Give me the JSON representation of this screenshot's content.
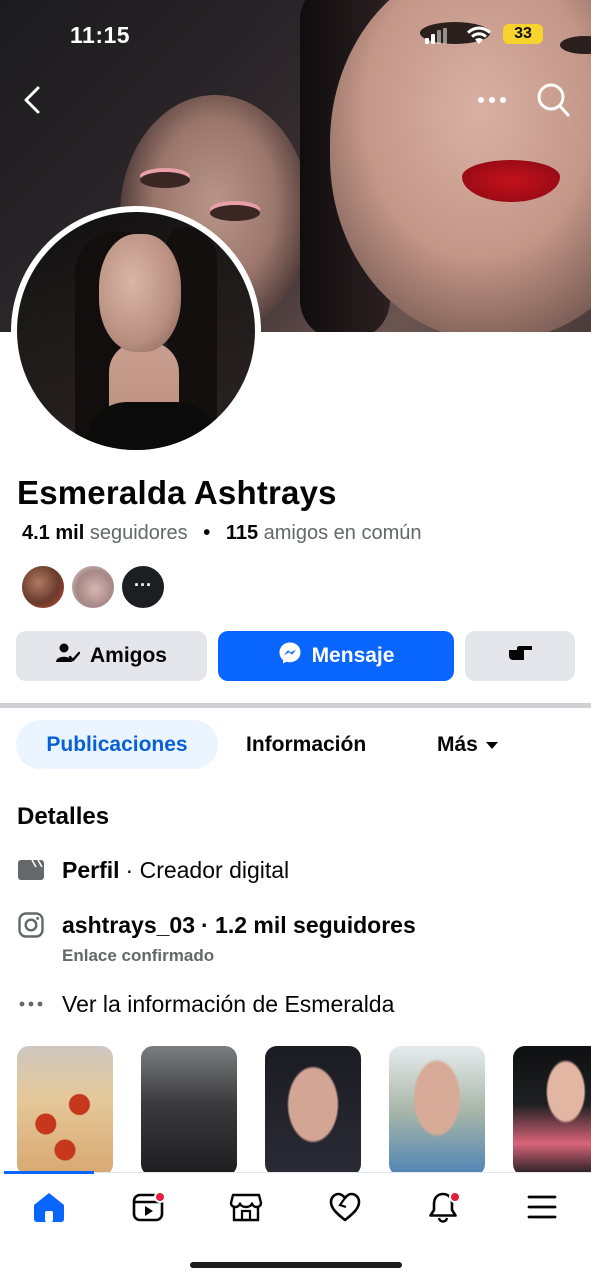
{
  "status_bar": {
    "time": "11:15",
    "battery": "33"
  },
  "profile": {
    "name": "Esmeralda Ashtrays",
    "followers_count": "4.1 mil",
    "followers_label": "seguidores",
    "mutual_count": "115",
    "mutual_label": "amigos en común",
    "more_mutual": "···"
  },
  "actions": {
    "friends_label": "Amigos",
    "message_label": "Mensaje"
  },
  "tabs": [
    {
      "label": "Publicaciones",
      "active": true
    },
    {
      "label": "Información",
      "active": false
    },
    {
      "label": "Más",
      "active": false
    }
  ],
  "details": {
    "title": "Detalles",
    "profile_label": "Perfil",
    "profile_value": "· Creador digital",
    "instagram_handle": "ashtrays_03",
    "instagram_followers": "· 1.2 mil seguidores",
    "instagram_sub": "Enlace confirmado",
    "see_more": "Ver la información de Esmeralda"
  },
  "icons": {
    "top": [
      "back-icon",
      "more-icon",
      "search-icon"
    ],
    "nav": [
      "home-icon",
      "video-icon",
      "marketplace-icon",
      "dating-icon",
      "notifications-icon",
      "menu-icon"
    ]
  },
  "colors": {
    "accent": "#0866ff",
    "active_tab_bg": "#ebf5ff",
    "button_gray": "#e4e6eb",
    "badge_red": "#e41e3f"
  }
}
